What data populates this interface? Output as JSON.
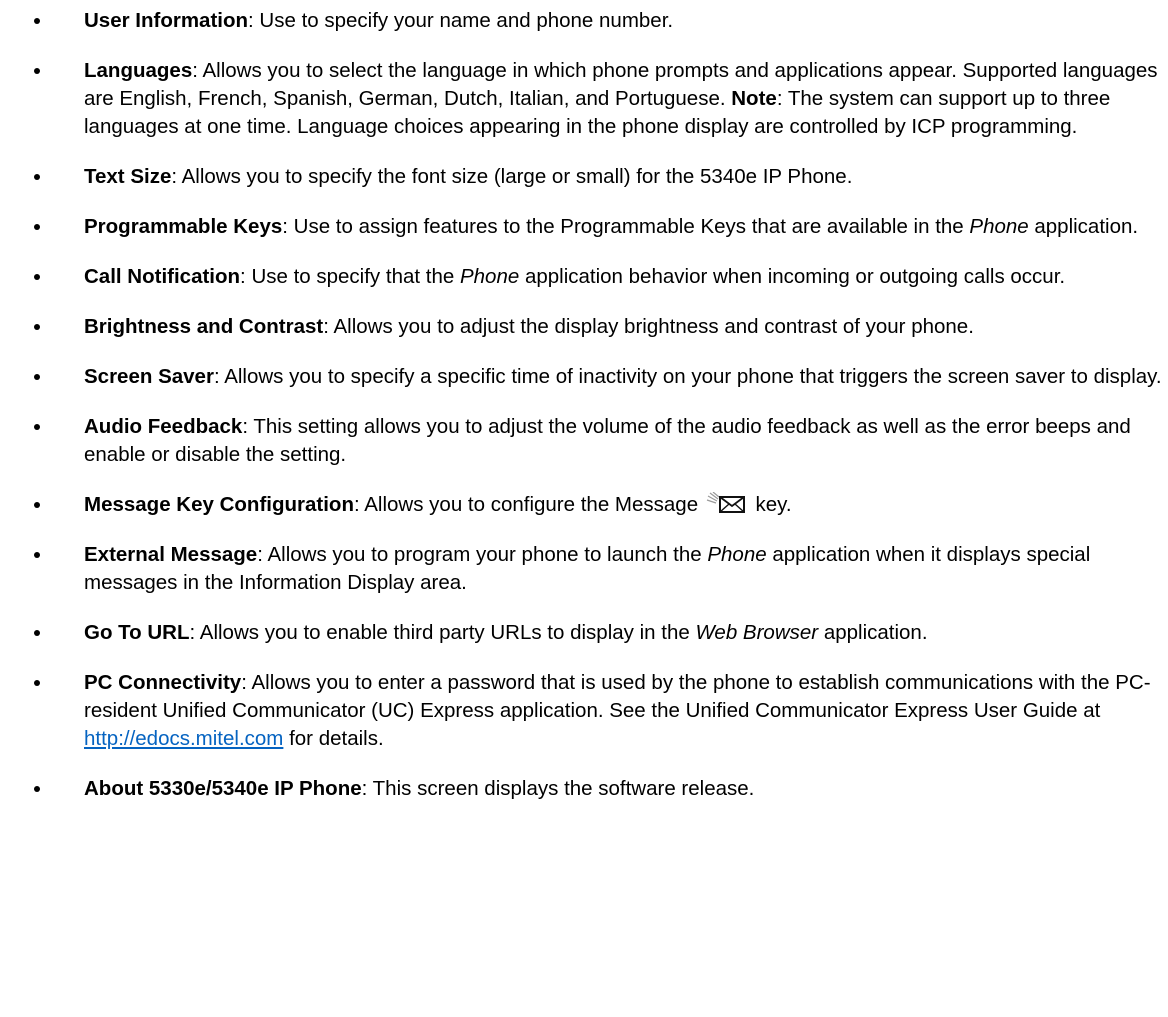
{
  "items": [
    {
      "term": "User Information",
      "text": ": Use to specify your name and phone number."
    },
    {
      "term": "Languages",
      "text1": ": Allows you to select the language in which phone prompts and applications appear. Supported languages are English, French, Spanish, German, Dutch, Italian, and Portuguese. ",
      "note_label": "Note",
      "text2": ": The system can support up to three languages at one time. Language choices appearing in the phone display are controlled by ICP programming."
    },
    {
      "term": "Text Size",
      "text": ": Allows you to specify the font size (large or small) for the 5340e IP Phone."
    },
    {
      "term": "Programmable Keys",
      "text1": ": Use to assign features to the Programmable Keys that are available in the ",
      "em": "Phone",
      "text2": " application."
    },
    {
      "term": "Call Notification",
      "text1": ": Use to specify that the ",
      "em": "Phone",
      "text2": " application behavior when incoming or outgoing calls occur."
    },
    {
      "term": "Brightness and Contrast",
      "text": ": Allows you to adjust the display brightness and contrast of your phone."
    },
    {
      "term": "Screen Saver",
      "text": ": Allows you to specify a specific time of inactivity on your phone that triggers the screen saver to display."
    },
    {
      "term": "Audio Feedback",
      "text": ": This setting allows you to adjust the volume of the audio feedback as well as the error beeps and enable or disable the setting."
    },
    {
      "term": "Message Key Configuration",
      "text1": ": Allows you to configure the Message ",
      "icon": "message-envelope-icon",
      "text2": " key."
    },
    {
      "term": "External Message",
      "text1": ": Allows you to program your phone to launch the ",
      "em": "Phone",
      "text2": " application when it displays special messages in the Information Display area."
    },
    {
      "term": "Go To URL",
      "text1": ": Allows you to enable third party URLs to display in the ",
      "em": "Web Browser",
      "text2": " application."
    },
    {
      "term": "PC Connectivity",
      "text1": ": Allows you to enter a password that is used by the phone to establish communications with the PC-resident Unified Communicator (UC) Express application. See the Unified Communicator Express User Guide at ",
      "link": "http://edocs.mitel.com",
      "text2": " for details."
    },
    {
      "term": "About 5330e/5340e IP Phone",
      "text": ": This screen displays the software release."
    }
  ],
  "colors": {
    "text": "#000000",
    "link": "#0563c1",
    "background": "#ffffff"
  }
}
